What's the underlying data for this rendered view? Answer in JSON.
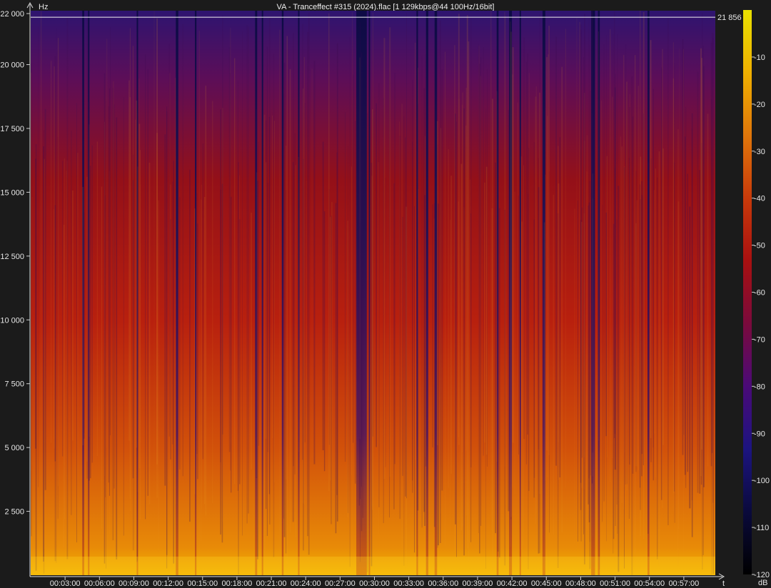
{
  "title": "VA - Tranceffect #315 (2024).flac [1 129kbps@44 100Hz/16bit]",
  "chart_data": {
    "type": "heatmap",
    "title": "VA - Tranceffect #315 (2024).flac [1 129kbps@44 100Hz/16bit]",
    "x_unit_label": "t",
    "y_unit_label": "Hz",
    "ylim": [
      0,
      22000
    ],
    "y_ticks": [
      {
        "value": 2500,
        "label": "2 500"
      },
      {
        "value": 5000,
        "label": "5 000"
      },
      {
        "value": 7500,
        "label": "7 500"
      },
      {
        "value": 10000,
        "label": "10 000"
      },
      {
        "value": 12500,
        "label": "12 500"
      },
      {
        "value": 15000,
        "label": "15 000"
      },
      {
        "value": 17500,
        "label": "17 500"
      },
      {
        "value": 20000,
        "label": "20 000"
      },
      {
        "value": 22000,
        "label": "22 000"
      }
    ],
    "x_ticks": [
      {
        "value": 180,
        "label": "00:03:00"
      },
      {
        "value": 360,
        "label": "00:06:00"
      },
      {
        "value": 540,
        "label": "00:09:00"
      },
      {
        "value": 720,
        "label": "00:12:00"
      },
      {
        "value": 900,
        "label": "00:15:00"
      },
      {
        "value": 1080,
        "label": "00:18:00"
      },
      {
        "value": 1260,
        "label": "00:21:00"
      },
      {
        "value": 1440,
        "label": "00:24:00"
      },
      {
        "value": 1620,
        "label": "00:27:00"
      },
      {
        "value": 1800,
        "label": "00:30:00"
      },
      {
        "value": 1980,
        "label": "00:33:00"
      },
      {
        "value": 2160,
        "label": "00:36:00"
      },
      {
        "value": 2340,
        "label": "00:39:00"
      },
      {
        "value": 2520,
        "label": "00:42:00"
      },
      {
        "value": 2700,
        "label": "00:45:00"
      },
      {
        "value": 2880,
        "label": "00:48:00"
      },
      {
        "value": 3060,
        "label": "00:51:00"
      },
      {
        "value": 3240,
        "label": "00:54:00"
      },
      {
        "value": 3420,
        "label": "00:57:00"
      }
    ],
    "xlim": [
      0,
      3585
    ],
    "cutoff": {
      "value": 21856,
      "label": "21 856"
    },
    "colorbar": {
      "unit": "dB",
      "range": [
        -120,
        0
      ],
      "ticks": [
        {
          "value": -10,
          "label": "-10"
        },
        {
          "value": -20,
          "label": "-20"
        },
        {
          "value": -30,
          "label": "-30"
        },
        {
          "value": -40,
          "label": "-40"
        },
        {
          "value": -50,
          "label": "-50"
        },
        {
          "value": -60,
          "label": "-60"
        },
        {
          "value": -70,
          "label": "-70"
        },
        {
          "value": -80,
          "label": "-80"
        },
        {
          "value": -90,
          "label": "-90"
        },
        {
          "value": -100,
          "label": "-100"
        },
        {
          "value": -110,
          "label": "-110"
        },
        {
          "value": -120,
          "label": "-120"
        }
      ],
      "stops": [
        "#000000",
        "#0a0a3c",
        "#1c1480",
        "#4a0a78",
        "#7a0a3c",
        "#a81010",
        "#c83a0a",
        "#e0760a",
        "#f0b000",
        "#e8e000"
      ]
    },
    "quiet_segments_seconds": [
      [
        270,
        280
      ],
      [
        300,
        306
      ],
      [
        555,
        562
      ],
      [
        760,
        773
      ],
      [
        860,
        868
      ],
      [
        1175,
        1186
      ],
      [
        1210,
        1215
      ],
      [
        1315,
        1324
      ],
      [
        1400,
        1406
      ],
      [
        1705,
        1760
      ],
      [
        1770,
        1776
      ],
      [
        2020,
        2028
      ],
      [
        2070,
        2082
      ],
      [
        2115,
        2128
      ],
      [
        2440,
        2450
      ],
      [
        2505,
        2520
      ],
      [
        2560,
        2566
      ],
      [
        2680,
        2695
      ],
      [
        2935,
        2955
      ],
      [
        2970,
        2980
      ],
      [
        3230,
        3240
      ]
    ]
  }
}
